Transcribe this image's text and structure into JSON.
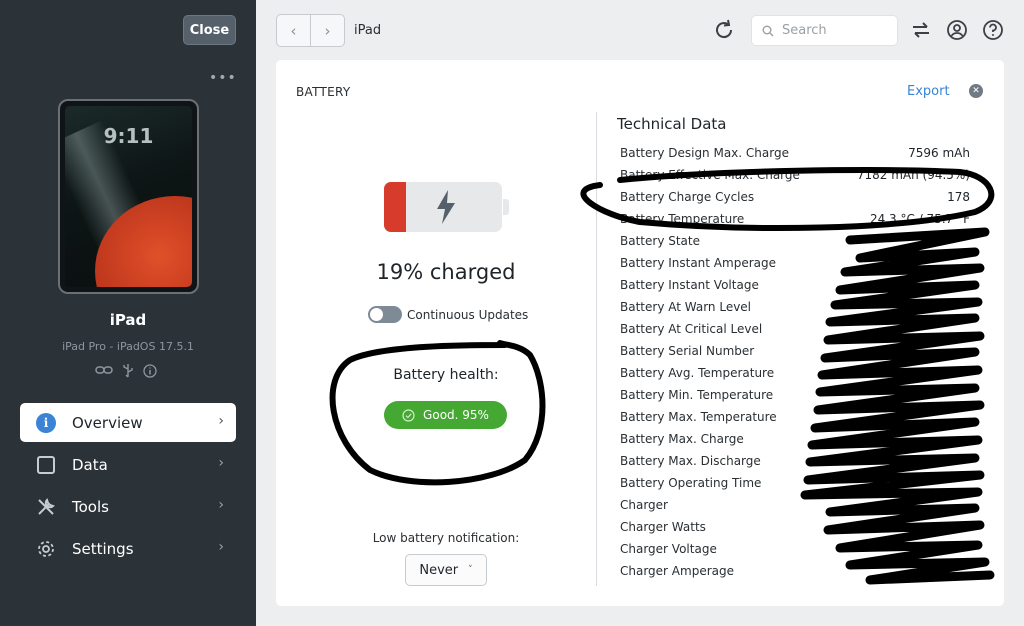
{
  "sidebar": {
    "close_label": "Close",
    "device_name": "iPad",
    "device_sub": "iPad Pro - iPadOS 17.5.1",
    "lock_time": "9:11",
    "more": "•••",
    "nav": [
      {
        "label": "Overview",
        "icon": "info-icon"
      },
      {
        "label": "Data",
        "icon": "data-icon"
      },
      {
        "label": "Tools",
        "icon": "tools-icon"
      },
      {
        "label": "Settings",
        "icon": "gear-icon"
      }
    ]
  },
  "topbar": {
    "breadcrumb": "iPad",
    "search_placeholder": "Search"
  },
  "panel": {
    "title": "BATTERY",
    "export_label": "Export",
    "charged_text": "19% charged",
    "charge_level": 0.19,
    "continuous_label": "Continuous Updates",
    "health_label": "Battery health:",
    "health_value": "Good. 95%",
    "low_battery_label": "Low battery notification:",
    "low_battery_value": "Never"
  },
  "tech": {
    "title": "Technical Data",
    "rows": [
      {
        "key": "Battery Design Max. Charge",
        "value": "7596 mAh"
      },
      {
        "key": "Battery Effective Max. Charge",
        "value": "7182 mAh (94.5%)"
      },
      {
        "key": "Battery Charge Cycles",
        "value": "178"
      },
      {
        "key": "Battery Temperature",
        "value": "24.3 °C / 75.7 °F"
      },
      {
        "key": "Battery State",
        "value": ""
      },
      {
        "key": "Battery Instant Amperage",
        "value": ""
      },
      {
        "key": "Battery Instant Voltage",
        "value": ""
      },
      {
        "key": "Battery At Warn Level",
        "value": ""
      },
      {
        "key": "Battery At Critical Level",
        "value": ""
      },
      {
        "key": "Battery Serial Number",
        "value": ""
      },
      {
        "key": "Battery Avg. Temperature",
        "value": ""
      },
      {
        "key": "Battery Min. Temperature",
        "value": ""
      },
      {
        "key": "Battery Max. Temperature",
        "value": ""
      },
      {
        "key": "Battery Max. Charge",
        "value": ""
      },
      {
        "key": "Battery Max. Discharge",
        "value": ""
      },
      {
        "key": "Battery Operating Time",
        "value": ""
      },
      {
        "key": "Charger",
        "value": ""
      },
      {
        "key": "Charger Watts",
        "value": ""
      },
      {
        "key": "Charger Voltage",
        "value": ""
      },
      {
        "key": "Charger Amperage",
        "value": ""
      }
    ]
  },
  "colors": {
    "sidebar_bg": "#2b3238",
    "accent": "#3b83d4",
    "battery_red": "#d63b2b",
    "health_green": "#45a832"
  }
}
